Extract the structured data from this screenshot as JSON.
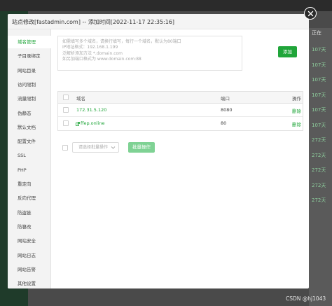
{
  "dialog": {
    "title": "站点修改[fastadmin.com] -- 添加时间[2022-11-17 22:35:16]"
  },
  "sidebar": {
    "items": [
      {
        "label": "域名管理",
        "active": true
      },
      {
        "label": "子目录绑定"
      },
      {
        "label": "网站目录"
      },
      {
        "label": "访问限制"
      },
      {
        "label": "流量限制"
      },
      {
        "label": "伪静态"
      },
      {
        "label": "默认文档"
      },
      {
        "label": "配置文件"
      },
      {
        "label": "SSL"
      },
      {
        "label": "PHP"
      },
      {
        "label": "重定向"
      },
      {
        "label": "反向代理"
      },
      {
        "label": "防盗链"
      },
      {
        "label": "防篡改"
      },
      {
        "label": "网站安全"
      },
      {
        "label": "网站日志"
      },
      {
        "label": "网站告警"
      },
      {
        "label": "其他设置"
      }
    ]
  },
  "domain_form": {
    "placeholder_lines": [
      "如需填写多个域名，请换行填写，每行一个域名，默认为80端口",
      "IP地址格式：192.168.1.199",
      "泛解析添加方法 *.domain.com",
      "如另加端口格式为 www.domain.com:88"
    ],
    "add_label": "添加"
  },
  "table": {
    "headers": {
      "domain": "域名",
      "port": "端口",
      "action": "操作"
    },
    "rows": [
      {
        "domain": "172.31.5.120",
        "port": "8080",
        "action": "删除"
      },
      {
        "domain": "ffep.online",
        "port": "80",
        "action": "删除"
      }
    ]
  },
  "batch": {
    "select_placeholder": "请选择批量操作",
    "button_label": "批量操作"
  },
  "background": {
    "right_header": "正在",
    "right_values": [
      "107天",
      "107天",
      "107天",
      "107天",
      "107天",
      "107天",
      "272天",
      "272天",
      "272天",
      "272天",
      "272天"
    ]
  },
  "watermark": "CSDN @hj1043",
  "colors": {
    "accent": "#20a53a",
    "accent_light": "#7fd294"
  }
}
